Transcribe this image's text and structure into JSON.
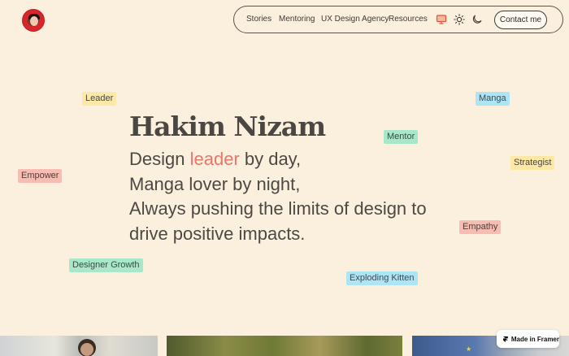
{
  "nav": {
    "links": [
      "Stories",
      "Mentoring",
      "UX Design Agency",
      "Resources"
    ],
    "icons": [
      "monitor-icon",
      "sun-icon",
      "moon-icon"
    ],
    "contact_label": "Contact me"
  },
  "hero": {
    "name": "Hakim Nizam",
    "line1_prefix": "Design ",
    "line1_accent": "leader",
    "line1_suffix": " by day,",
    "line2": "Manga lover by night,",
    "line3": "Always pushing the limits of design to",
    "line4": "drive positive impacts."
  },
  "tags": {
    "leader": "Leader",
    "manga": "Manga",
    "mentor": "Mentor",
    "strategist": "Strategist",
    "empower": "Empower",
    "empathy": "Empathy",
    "designer_growth": "Designer Growth",
    "exploding_kitten": "Exploding Kitten"
  },
  "badge": {
    "label": "Made in Framer"
  },
  "colors": {
    "background": "#fbf0de",
    "accent": "#e8766a",
    "tag_yellow": "#fde9a5",
    "tag_blue": "#aee5f4",
    "tag_green": "#a8e8c8",
    "tag_red": "#f7bdb2"
  }
}
